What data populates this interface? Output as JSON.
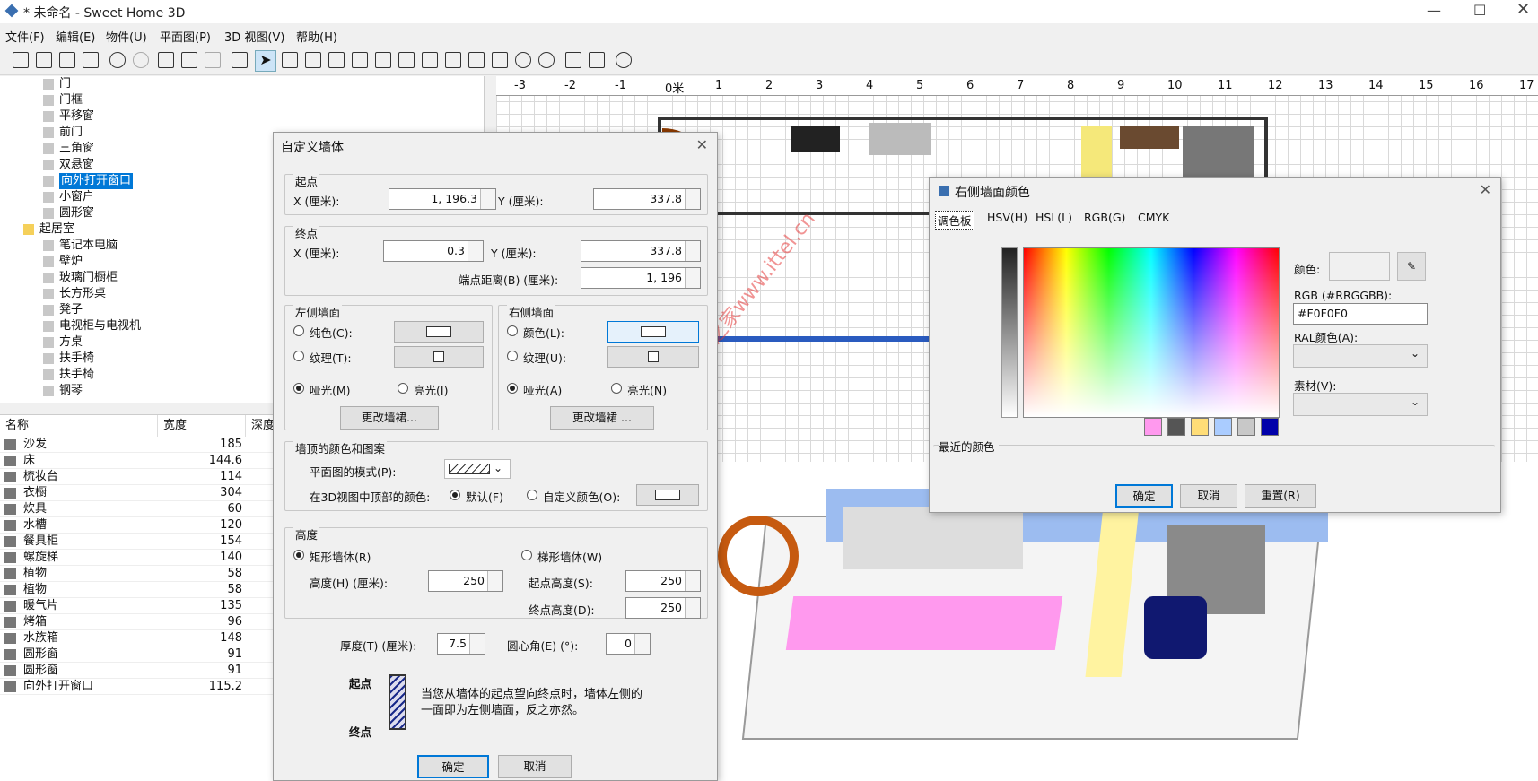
{
  "app": {
    "title": "* 未命名 - Sweet Home 3D"
  },
  "menu": [
    "文件(F)",
    "编辑(E)",
    "物件(U)",
    "平面图(P)",
    "3D 视图(V)",
    "帮助(H)"
  ],
  "tree": {
    "items": [
      {
        "label": "门",
        "indent": 1
      },
      {
        "label": "门框",
        "indent": 1
      },
      {
        "label": "平移窗",
        "indent": 1
      },
      {
        "label": "前门",
        "indent": 1
      },
      {
        "label": "三角窗",
        "indent": 1
      },
      {
        "label": "双悬窗",
        "indent": 1
      },
      {
        "label": "向外打开窗口",
        "indent": 1,
        "selected": true
      },
      {
        "label": "小窗户",
        "indent": 1
      },
      {
        "label": "圆形窗",
        "indent": 1
      },
      {
        "label": "起居室",
        "indent": 0,
        "folder": true
      },
      {
        "label": "笔记本电脑",
        "indent": 1
      },
      {
        "label": "壁炉",
        "indent": 1
      },
      {
        "label": "玻璃门橱柜",
        "indent": 1
      },
      {
        "label": "长方形桌",
        "indent": 1
      },
      {
        "label": "凳子",
        "indent": 1
      },
      {
        "label": "电视柜与电视机",
        "indent": 1
      },
      {
        "label": "方桌",
        "indent": 1
      },
      {
        "label": "扶手椅",
        "indent": 1
      },
      {
        "label": "扶手椅",
        "indent": 1
      },
      {
        "label": "钢琴",
        "indent": 1
      }
    ]
  },
  "furniture": {
    "headers": [
      "名称",
      "宽度",
      "深度"
    ],
    "rows": [
      {
        "name": "沙发",
        "width": "185"
      },
      {
        "name": "床",
        "width": "144.6"
      },
      {
        "name": "梳妆台",
        "width": "114"
      },
      {
        "name": "衣橱",
        "width": "304"
      },
      {
        "name": "炊具",
        "width": "60"
      },
      {
        "name": "水槽",
        "width": "120"
      },
      {
        "name": "餐具柜",
        "width": "154"
      },
      {
        "name": "螺旋梯",
        "width": "140"
      },
      {
        "name": "植物",
        "width": "58"
      },
      {
        "name": "植物",
        "width": "58"
      },
      {
        "name": "暖气片",
        "width": "135"
      },
      {
        "name": "烤箱",
        "width": "96"
      },
      {
        "name": "水族箱",
        "width": "148"
      },
      {
        "name": "圆形窗",
        "width": "91"
      },
      {
        "name": "圆形窗",
        "width": "91"
      },
      {
        "name": "向外打开窗口",
        "width": "115.2"
      }
    ]
  },
  "ruler": [
    "-3",
    "-2",
    "-1",
    "0米",
    "1",
    "2",
    "3",
    "4",
    "5",
    "6",
    "7",
    "8",
    "9",
    "10",
    "11",
    "12",
    "13",
    "14",
    "15",
    "16",
    "17"
  ],
  "watermark": "IT技术之家www.ittel.cn",
  "wall_dialog": {
    "title": "自定义墙体",
    "start": {
      "legend": "起点",
      "x_label": "X (厘米):",
      "x": "1, 196.3",
      "y_label": "Y (厘米):",
      "y": "337.8"
    },
    "end": {
      "legend": "终点",
      "x_label": "X (厘米):",
      "x": "0.3",
      "y_label": "Y (厘米):",
      "y": "337.8",
      "dist_label": "端点距离(B) (厘米):",
      "dist": "1, 196"
    },
    "left": {
      "legend": "左侧墙面",
      "color": "纯色(C):",
      "texture": "纹理(T):",
      "matt": "哑光(M)",
      "shiny": "亮光(I)",
      "baseboard": "更改墙裙..."
    },
    "right": {
      "legend": "右侧墙面",
      "color": "颜色(L):",
      "texture": "纹理(U):",
      "matt": "哑光(A)",
      "shiny": "亮光(N)",
      "baseboard": "更改墙裙 ..."
    },
    "top": {
      "legend": "墙顶的颜色和图案",
      "pattern_label": "平面图的模式(P):",
      "color3d_label": "在3D视图中顶部的颜色:",
      "default": "默认(F)",
      "custom": "自定义颜色(O):"
    },
    "height": {
      "legend": "高度",
      "rect": "矩形墙体(R)",
      "trap": "梯形墙体(W)",
      "h_label": "高度(H) (厘米):",
      "h": "250",
      "sh_label": "起点高度(S):",
      "sh": "250",
      "eh_label": "终点高度(D):",
      "eh": "250"
    },
    "thickness_label": "厚度(T) (厘米):",
    "thickness": "7.5",
    "arc_label": "圆心角(E) (°):",
    "arc": "0",
    "diagram": {
      "start": "起点",
      "end": "终点"
    },
    "hint": "当您从墙体的起点望向终点时，墙体左侧的一面即为左侧墙面，反之亦然。",
    "ok": "确定",
    "cancel": "取消"
  },
  "color_dialog": {
    "title": "右侧墙面颜色",
    "tabs": [
      "调色板",
      "HSV(H)",
      "HSL(L)",
      "RGB(G)",
      "CMYK"
    ],
    "color_label": "颜色:",
    "rgb_label": "RGB (#RRGGBB):",
    "rgb": "#F0F0F0",
    "ral_label": "RAL颜色(A):",
    "material_label": "素材(V):",
    "recent_label": "最近的颜色",
    "recent": [
      "#ff99ee",
      "#555555",
      "#ffdd77",
      "#aaccff",
      "#c8c8c8",
      "#0000aa"
    ],
    "ok": "确定",
    "cancel": "取消",
    "reset": "重置(R)"
  }
}
